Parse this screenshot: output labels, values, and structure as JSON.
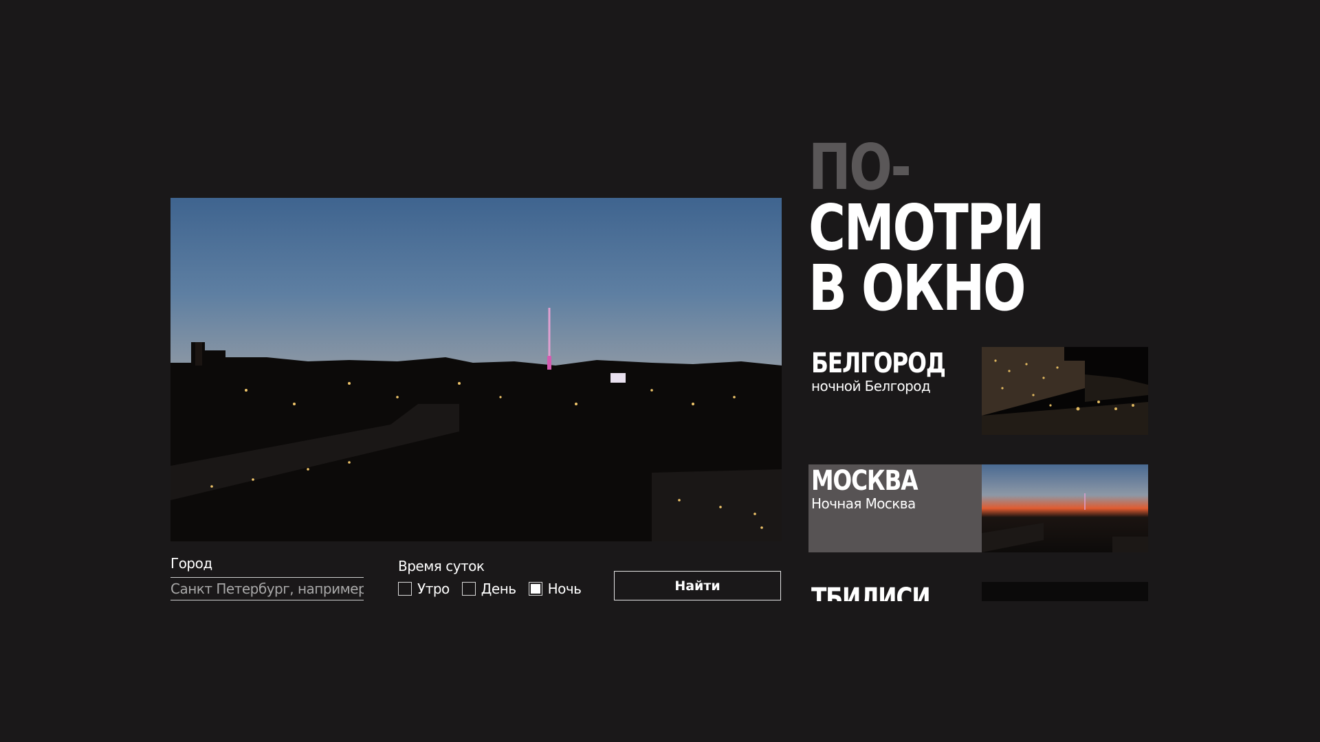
{
  "title": {
    "line1": "ПО-",
    "line2": "СМОТРИ",
    "line3": "В ОКНО"
  },
  "search": {
    "city_label": "Город",
    "city_placeholder": "Санкт Петербург, например",
    "time_label": "Время суток",
    "options": [
      {
        "label": "Утро",
        "checked": false
      },
      {
        "label": "День",
        "checked": false
      },
      {
        "label": "Ночь",
        "checked": true
      }
    ],
    "find_label": "Найти"
  },
  "cities": [
    {
      "name": "БЕЛГОРОД",
      "subtitle": "ночной Белгород",
      "active": false,
      "thumb": "belgorod-night-thumbnail"
    },
    {
      "name": "МОСКВА",
      "subtitle": "Ночная Москва",
      "active": true,
      "thumb": "moscow-sunset-thumbnail"
    },
    {
      "name": "ТБИЛИСИ",
      "subtitle": "",
      "active": false,
      "thumb": "tbilisi-thumbnail"
    }
  ],
  "colors": {
    "background": "#1a1819",
    "title_muted": "#5a5758",
    "active_card": "#575354"
  }
}
